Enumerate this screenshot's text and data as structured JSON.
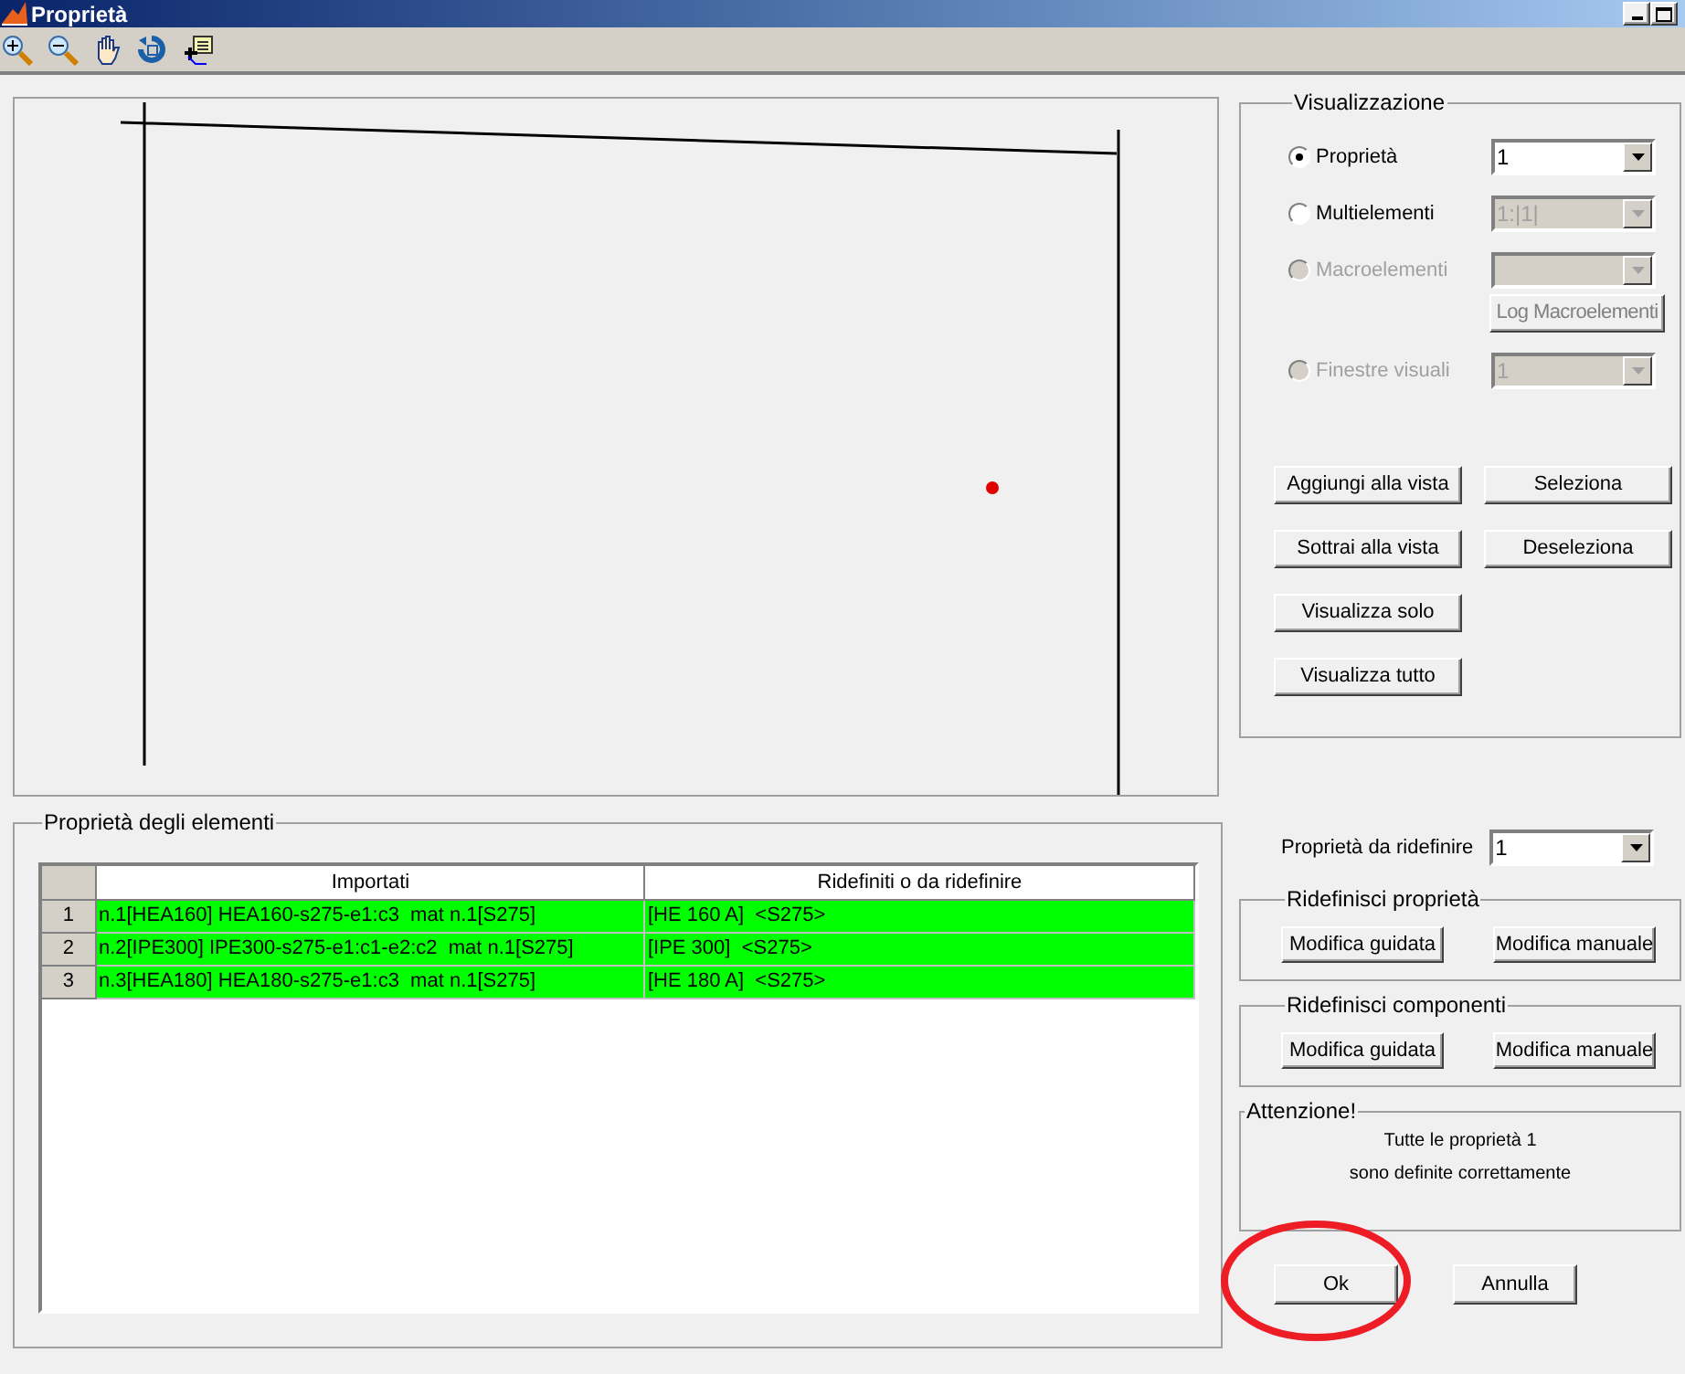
{
  "window": {
    "title": "Proprietà"
  },
  "visualizzazione": {
    "title": "Visualizzazione",
    "options": [
      {
        "label": "Proprietà",
        "selected": true,
        "disabled": false,
        "dropdown": {
          "value": "1",
          "disabled": false
        }
      },
      {
        "label": "Multielementi",
        "selected": false,
        "disabled": false,
        "dropdown": {
          "value": "1:|1|",
          "disabled": true
        }
      },
      {
        "label": "Macroelementi",
        "selected": false,
        "disabled": true,
        "dropdown": {
          "disabled": true
        },
        "extra_button": {
          "label": "Log Macroelementi",
          "disabled": true
        }
      },
      {
        "label": "Finestre visuali",
        "selected": false,
        "disabled": true,
        "dropdown": {
          "value": "1",
          "disabled": true
        }
      }
    ],
    "buttons": [
      [
        "Aggiungi alla vista",
        "Seleziona"
      ],
      [
        "Sottrai alla vista",
        "Deseleziona"
      ],
      [
        "Visualizza solo"
      ],
      [
        "Visualizza tutto"
      ]
    ]
  },
  "elements": {
    "title": "Proprietà degli elementi",
    "table": {
      "columns": [
        "Importati",
        "Ridefiniti o da ridefinire"
      ],
      "rows": [
        {
          "index": "1",
          "cells": [
            "n.1[HEA160] HEA160-s275-e1:c3  mat n.1[S275]",
            "[HE 160 A]  <S275>"
          ],
          "color": "#00ff00"
        },
        {
          "index": "2",
          "cells": [
            "n.2[IPE300] IPE300-s275-e1:c1-e2:c2  mat n.1[S275]",
            "[IPE 300]  <S275>"
          ],
          "color": "#00ff00"
        },
        {
          "index": "3",
          "cells": [
            "n.3[HEA180] HEA180-s275-e1:c3  mat n.1[S275]",
            "[HE 180 A]  <S275>"
          ],
          "color": "#00ff00"
        }
      ]
    }
  },
  "redefine": {
    "label": "Proprietà da ridefinire",
    "value": "1"
  },
  "ridefinisci_proprieta": {
    "title": "Ridefinisci proprietà",
    "buttons": [
      "Modifica guidata",
      "Modifica manuale"
    ]
  },
  "ridefinisci_componenti": {
    "title": "Ridefinisci componenti",
    "buttons": [
      "Modifica guidata",
      "Modifica manuale"
    ]
  },
  "attenzione": {
    "title": "Attenzione!",
    "lines": [
      "Tutte le proprietà 1",
      "sono definite correttamente"
    ]
  },
  "footer_buttons": [
    {
      "label": "Ok",
      "circled": true
    },
    {
      "label": "Annulla",
      "circled": false
    }
  ]
}
